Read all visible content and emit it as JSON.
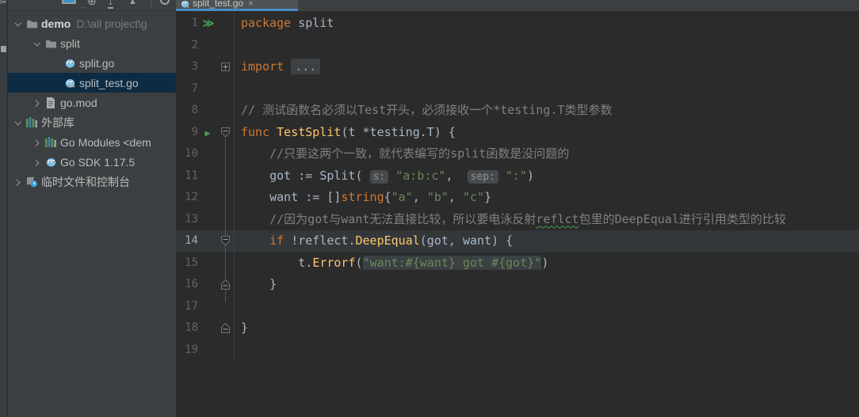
{
  "colors": {
    "editor_bg": "#2b2b2b",
    "panel_bg": "#3c3f41",
    "selection_bg": "#0d2c44",
    "tab_underline": "#4a88c7",
    "keyword": "#cc7832",
    "function": "#ffc66d",
    "string": "#6a8759",
    "comment": "#808080",
    "run_green": "#499c54"
  },
  "toolbar": {
    "icons": [
      "screen-icon",
      "overflow-dots",
      "plus-circle-icon",
      "download-icon",
      "collapse-icon",
      "divider",
      "settings-gear-icon"
    ],
    "plus_glyph": "⊕",
    "down_glyph": "↓",
    "up_glyph": "▲",
    "dots_glyph": ".."
  },
  "stripe": {
    "icons": [
      "cut-icon",
      "tool-square-icon"
    ],
    "cut_glyph": "✂"
  },
  "project_tree": {
    "items": [
      {
        "indent": 1,
        "chevron": "down",
        "icon": "folder",
        "label": "demo",
        "bold": true,
        "path": "D:\\all project\\g",
        "selected": false
      },
      {
        "indent": 2,
        "chevron": "down",
        "icon": "folder",
        "label": "split",
        "bold": false,
        "path": "",
        "selected": false
      },
      {
        "indent": 3,
        "chevron": "none",
        "icon": "go-file",
        "label": "split.go",
        "bold": false,
        "path": "",
        "selected": false
      },
      {
        "indent": 3,
        "chevron": "none",
        "icon": "go-test-file",
        "label": "split_test.go",
        "bold": false,
        "path": "",
        "selected": true
      },
      {
        "indent": 2,
        "chevron": "right",
        "icon": "doc-file",
        "label": "go.mod",
        "bold": false,
        "path": "",
        "selected": false
      },
      {
        "indent": 1,
        "chevron": "down",
        "icon": "library",
        "label": "外部库",
        "bold": false,
        "path": "",
        "selected": false
      },
      {
        "indent": 2,
        "chevron": "right",
        "icon": "library",
        "label": "Go Modules <dem",
        "bold": false,
        "path": "",
        "selected": false
      },
      {
        "indent": 2,
        "chevron": "right",
        "icon": "go-sdk",
        "label": "Go SDK 1.17.5",
        "bold": false,
        "path": "",
        "selected": false
      },
      {
        "indent": 1,
        "chevron": "right",
        "icon": "scratches",
        "label": "临时文件和控制台",
        "bold": false,
        "path": "",
        "selected": false
      }
    ]
  },
  "editor": {
    "tab": {
      "title": "split_test.go",
      "close_label": "×"
    },
    "lines": [
      {
        "num": "1",
        "run": "run-all",
        "fold": "none",
        "current": false,
        "tokens": [
          [
            "kw",
            "package"
          ],
          [
            "def",
            " split"
          ]
        ]
      },
      {
        "num": "2",
        "run": "",
        "fold": "none",
        "current": false,
        "tokens": []
      },
      {
        "num": "3",
        "run": "",
        "fold": "plus",
        "current": false,
        "tokens": [
          [
            "kw",
            "import"
          ],
          [
            "def",
            " "
          ],
          [
            "foldchip",
            "..."
          ]
        ]
      },
      {
        "num": "7",
        "run": "",
        "fold": "none",
        "current": false,
        "tokens": []
      },
      {
        "num": "8",
        "run": "",
        "fold": "none",
        "current": false,
        "tokens": [
          [
            "com",
            "// 测试函数名必须以Test开头，必须接收一个*testing.T类型参数"
          ]
        ]
      },
      {
        "num": "9",
        "run": "run-test",
        "fold": "open",
        "current": false,
        "tokens": [
          [
            "kw",
            "func"
          ],
          [
            "fn",
            " TestSplit"
          ],
          [
            "def",
            "(t *testing.T) {"
          ]
        ]
      },
      {
        "num": "10",
        "run": "",
        "fold": "none",
        "current": false,
        "tokens": [
          [
            "com",
            "    //只要这两个一致，就代表编写的split函数是没问题的"
          ]
        ]
      },
      {
        "num": "11",
        "run": "",
        "fold": "none",
        "current": false,
        "tokens": [
          [
            "def",
            "    got := Split( "
          ],
          [
            "hint",
            "s:"
          ],
          [
            "def",
            " "
          ],
          [
            "str",
            "\"a:b:c\""
          ],
          [
            "def",
            ",  "
          ],
          [
            "hint",
            "sep:"
          ],
          [
            "def",
            " "
          ],
          [
            "str",
            "\":\""
          ],
          [
            "def",
            ")"
          ]
        ]
      },
      {
        "num": "12",
        "run": "",
        "fold": "none",
        "current": false,
        "tokens": [
          [
            "def",
            "    want := []"
          ],
          [
            "kw",
            "string"
          ],
          [
            "def",
            "{"
          ],
          [
            "str",
            "\"a\""
          ],
          [
            "def",
            ", "
          ],
          [
            "str",
            "\"b\""
          ],
          [
            "def",
            ", "
          ],
          [
            "str",
            "\"c\""
          ],
          [
            "def",
            "}"
          ]
        ]
      },
      {
        "num": "13",
        "run": "",
        "fold": "none",
        "current": false,
        "tokens": [
          [
            "com",
            "    //因为got与want无法直接比较，所以要电泳反射"
          ],
          [
            "comerr",
            "reflct"
          ],
          [
            "com",
            "包里的DeepEqual进行引用类型的比较"
          ]
        ]
      },
      {
        "num": "14",
        "run": "",
        "fold": "open",
        "current": true,
        "tokens": [
          [
            "def",
            "    "
          ],
          [
            "kw",
            "if"
          ],
          [
            "def",
            " !reflect."
          ],
          [
            "fn",
            "DeepEqual"
          ],
          [
            "def",
            "(got, want) {"
          ]
        ]
      },
      {
        "num": "15",
        "run": "",
        "fold": "none",
        "current": false,
        "tokens": [
          [
            "def",
            "        t."
          ],
          [
            "fn",
            "Errorf"
          ],
          [
            "def",
            "("
          ],
          [
            "strhl",
            "\"want:#{want} got #{got}\""
          ],
          [
            "def",
            ")"
          ]
        ]
      },
      {
        "num": "16",
        "run": "",
        "fold": "close",
        "current": false,
        "tokens": [
          [
            "def",
            "    }"
          ]
        ]
      },
      {
        "num": "17",
        "run": "",
        "fold": "none",
        "current": false,
        "tokens": []
      },
      {
        "num": "18",
        "run": "",
        "fold": "close",
        "current": false,
        "tokens": [
          [
            "def",
            "}"
          ]
        ]
      },
      {
        "num": "19",
        "run": "",
        "fold": "none",
        "current": false,
        "tokens": []
      }
    ]
  }
}
